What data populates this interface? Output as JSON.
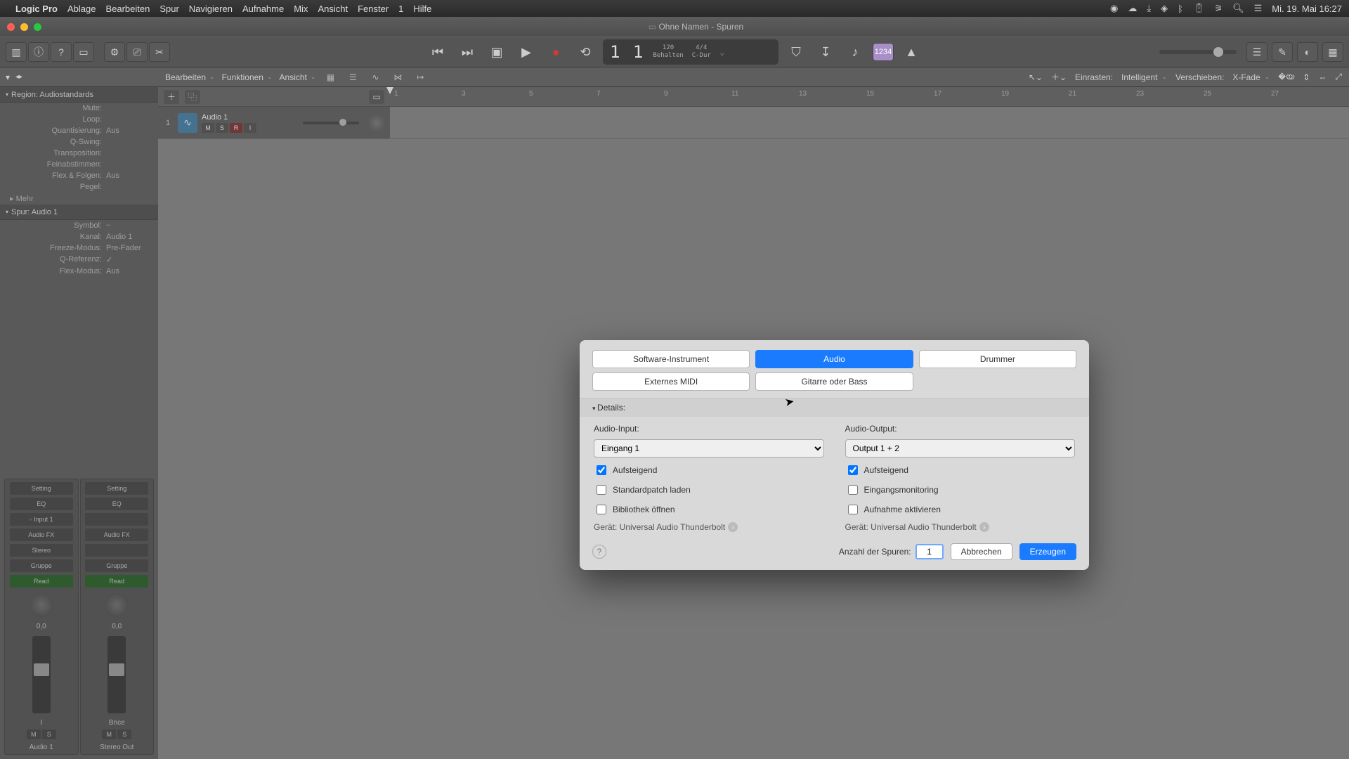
{
  "menubar": {
    "app": "Logic Pro",
    "items": [
      "Ablage",
      "Bearbeiten",
      "Spur",
      "Navigieren",
      "Aufnahme",
      "Mix",
      "Ansicht",
      "Fenster",
      "1",
      "Hilfe"
    ],
    "right_icons": [
      "record-icon",
      "cloud-icon",
      "cloud-down-icon",
      "dropbox-icon",
      "bluetooth-icon",
      "battery-icon",
      "wifi-icon",
      "search-icon",
      "control-center-icon"
    ],
    "clock": "Mi. 19. Mai  16:27"
  },
  "window": {
    "title": "Ohne Namen - Spuren"
  },
  "toolbar": {
    "lcd": {
      "bars": "1  1",
      "tempo": "120",
      "tempo_sub": "Behalten",
      "sig": "4/4",
      "key": "C-Dur"
    },
    "mode_badge": "1234"
  },
  "secbar": {
    "left": {
      "arrow": "◂▸"
    },
    "edit": "Bearbeiten",
    "func": "Funktionen",
    "view": "Ansicht",
    "snap_label": "Einrasten:",
    "snap_value": "Intelligent",
    "move_label": "Verschieben:",
    "move_value": "X-Fade"
  },
  "inspector": {
    "region_header": "Region:  Audiostandards",
    "region_rows": [
      {
        "k": "Mute:",
        "v": ""
      },
      {
        "k": "Loop:",
        "v": ""
      },
      {
        "k": "Quantisierung:",
        "v": "Aus"
      },
      {
        "k": "Q-Swing:",
        "v": ""
      },
      {
        "k": "Transposition:",
        "v": ""
      },
      {
        "k": "Feinabstimmen:",
        "v": ""
      },
      {
        "k": "Flex & Folgen:",
        "v": "Aus"
      },
      {
        "k": "Pegel:",
        "v": ""
      }
    ],
    "more": "▸ Mehr",
    "track_header": "Spur:  Audio 1",
    "track_rows": [
      {
        "k": "Symbol:",
        "v": "~"
      },
      {
        "k": "Kanal:",
        "v": "Audio 1"
      },
      {
        "k": "Freeze-Modus:",
        "v": "Pre-Fader"
      },
      {
        "k": "Q-Referenz:",
        "v": "✓"
      },
      {
        "k": "Flex-Modus:",
        "v": "Aus"
      }
    ],
    "strip1": {
      "setting": "Setting",
      "eq": "EQ",
      "input": "Input 1",
      "audiofx": "Audio FX",
      "stereo": "Stereo",
      "group": "Gruppe",
      "read": "Read",
      "db": "0,0",
      "io": "I",
      "m": "M",
      "s": "S",
      "name": "Audio 1"
    },
    "strip2": {
      "setting": "Setting",
      "eq": "EQ",
      "input": "",
      "audiofx": "Audio FX",
      "stereo": "",
      "group": "Gruppe",
      "read": "Read",
      "db": "0,0",
      "io": "Bnce",
      "m": "M",
      "s": "S",
      "name": "Stereo Out"
    }
  },
  "ruler": {
    "marks": [
      "1",
      "3",
      "5",
      "7",
      "9",
      "11",
      "13",
      "15",
      "17",
      "19",
      "21",
      "23",
      "25",
      "27"
    ]
  },
  "track": {
    "num": "1",
    "name": "Audio 1",
    "m": "M",
    "s": "S",
    "r": "R",
    "i": "I"
  },
  "modal": {
    "tabs": [
      "Software-Instrument",
      "Audio",
      "Drummer"
    ],
    "tabs2": [
      "Externes MIDI",
      "Gitarre oder Bass"
    ],
    "details": "Details:",
    "left": {
      "input_label": "Audio-Input:",
      "input_value": "Eingang 1",
      "chk_asc": "Aufsteigend",
      "chk_std": "Standardpatch laden",
      "chk_lib": "Bibliothek öffnen",
      "device": "Gerät: Universal Audio Thunderbolt"
    },
    "right": {
      "output_label": "Audio-Output:",
      "output_value": "Output 1 + 2",
      "chk_asc": "Aufsteigend",
      "chk_mon": "Eingangsmonitoring",
      "chk_rec": "Aufnahme aktivieren",
      "device": "Gerät: Universal Audio Thunderbolt"
    },
    "count_label": "Anzahl der Spuren:",
    "count_value": "1",
    "cancel": "Abbrechen",
    "create": "Erzeugen"
  }
}
